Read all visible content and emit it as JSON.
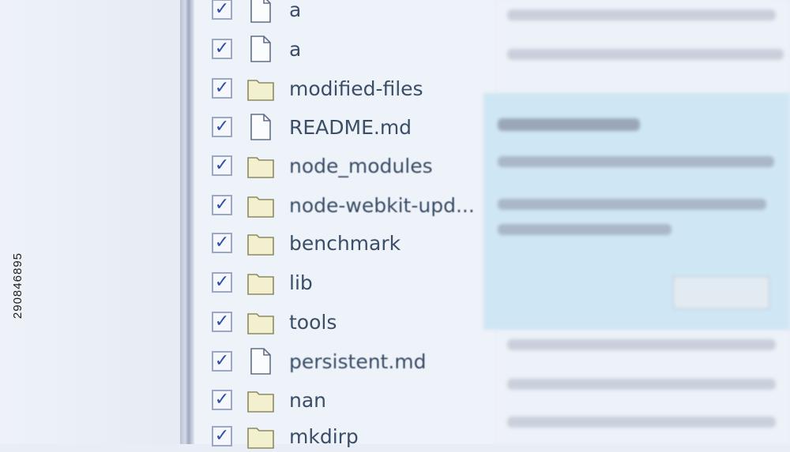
{
  "stock_id": "290846895",
  "files": [
    {
      "name": "a",
      "type": "file",
      "checked": true
    },
    {
      "name": "a",
      "type": "file",
      "checked": true
    },
    {
      "name": "modified-files",
      "type": "folder",
      "checked": true
    },
    {
      "name": "README.md",
      "type": "file",
      "checked": true
    },
    {
      "name": "node_modules",
      "type": "folder",
      "checked": true
    },
    {
      "name": "node-webkit-upd...",
      "type": "folder",
      "checked": true
    },
    {
      "name": "benchmark",
      "type": "folder",
      "checked": true
    },
    {
      "name": "lib",
      "type": "folder",
      "checked": true
    },
    {
      "name": "tools",
      "type": "folder",
      "checked": true
    },
    {
      "name": "persistent.md",
      "type": "file",
      "checked": true
    },
    {
      "name": "nan",
      "type": "folder",
      "checked": true
    },
    {
      "name": "mkdirp",
      "type": "folder",
      "checked": true
    }
  ]
}
